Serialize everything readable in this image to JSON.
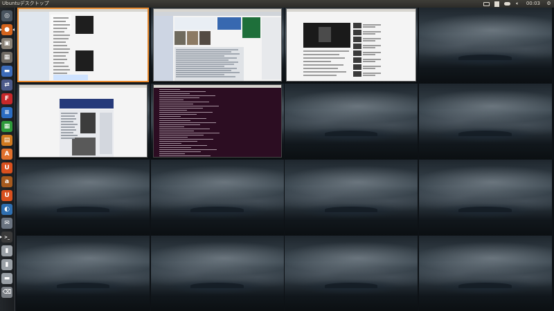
{
  "top_panel": {
    "title": "Ubuntuデスクトップ",
    "clock": "00:03",
    "tray": [
      "keyboard-indicator",
      "network-indicator",
      "cloud-indicator",
      "volume-indicator",
      "session-gear"
    ]
  },
  "launcher": {
    "items": [
      {
        "name": "dash-home",
        "glyph": "◎",
        "color": "#4a5560"
      },
      {
        "name": "firefox",
        "glyph": "●",
        "color": "#d4641d"
      },
      {
        "name": "files",
        "glyph": "▣",
        "color": "#8a8277"
      },
      {
        "name": "system-settings",
        "glyph": "▦",
        "color": "#6f6a63"
      },
      {
        "name": "disk",
        "glyph": "▬",
        "color": "#3c6bb8"
      },
      {
        "name": "network-share",
        "glyph": "⇄",
        "color": "#4c5a8a"
      },
      {
        "name": "filezilla",
        "glyph": "F",
        "color": "#c6282a"
      },
      {
        "name": "libreoffice-writer",
        "glyph": "≡",
        "color": "#2b6cc1"
      },
      {
        "name": "libreoffice-calc",
        "glyph": "▦",
        "color": "#2d9a3a"
      },
      {
        "name": "libreoffice-impress",
        "glyph": "▤",
        "color": "#d07a20"
      },
      {
        "name": "ubuntu-software",
        "glyph": "A",
        "color": "#e0702c"
      },
      {
        "name": "ubuntu-one",
        "glyph": "U",
        "color": "#d9501e"
      },
      {
        "name": "amazon",
        "glyph": "a",
        "color": "#a65a1e"
      },
      {
        "name": "ubuntu-one-music",
        "glyph": "U",
        "color": "#d9501e"
      },
      {
        "name": "workspace-switcher",
        "glyph": "◐",
        "color": "#2f6fb0"
      },
      {
        "name": "mail",
        "glyph": "✉",
        "color": "#6b7480"
      },
      {
        "name": "terminal",
        "glyph": ">_",
        "color": "#3a3a3a"
      },
      {
        "name": "drive-a",
        "glyph": "▮",
        "color": "#9aa0a6"
      },
      {
        "name": "drive-b",
        "glyph": "▮",
        "color": "#9aa0a6"
      },
      {
        "name": "drive-c",
        "glyph": "▬",
        "color": "#9aa0a6"
      },
      {
        "name": "trash",
        "glyph": "⌫",
        "color": "#7a7f85"
      }
    ]
  },
  "workspaces": {
    "count": 16,
    "columns": 4,
    "rows": 4
  }
}
